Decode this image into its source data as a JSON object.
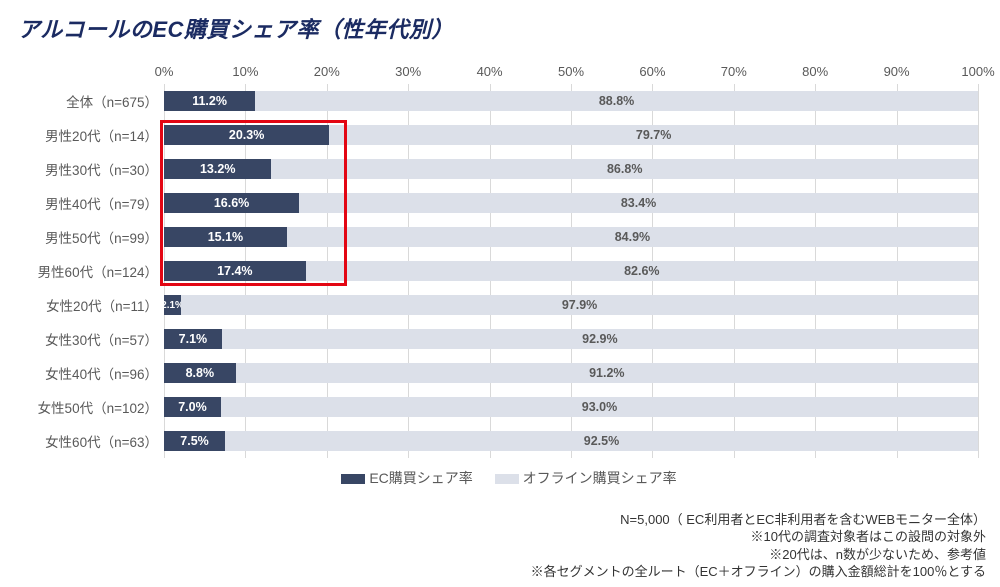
{
  "title": "アルコールのEC購買シェア率（性年代別）",
  "chart_data": {
    "type": "bar",
    "orientation": "horizontal-stacked-100",
    "categories": [
      "全体（n=675）",
      "男性20代（n=14）",
      "男性30代（n=30）",
      "男性40代（n=79）",
      "男性50代（n=99）",
      "男性60代（n=124）",
      "女性20代（n=11）",
      "女性30代（n=57）",
      "女性40代（n=96）",
      "女性50代（n=102）",
      "女性60代（n=63）"
    ],
    "series": [
      {
        "name": "EC購買シェア率",
        "color": "#384664",
        "values": [
          11.2,
          20.3,
          13.2,
          16.6,
          15.1,
          17.4,
          2.1,
          7.1,
          8.8,
          7.0,
          7.5
        ],
        "labels": [
          "11.2%",
          "20.3%",
          "13.2%",
          "16.6%",
          "15.1%",
          "17.4%",
          "2.1%",
          "7.1%",
          "8.8%",
          "7.0%",
          "7.5%"
        ]
      },
      {
        "name": "オフライン購買シェア率",
        "color": "#dce0e9",
        "values": [
          88.8,
          79.7,
          86.8,
          83.4,
          84.9,
          82.6,
          97.9,
          92.9,
          91.2,
          93.0,
          92.5
        ],
        "labels": [
          "88.8%",
          "79.7%",
          "86.8%",
          "83.4%",
          "84.9%",
          "82.6%",
          "97.9%",
          "92.9%",
          "91.2%",
          "93.0%",
          "92.5%"
        ]
      }
    ],
    "xticks": [
      "0%",
      "10%",
      "20%",
      "30%",
      "40%",
      "50%",
      "60%",
      "70%",
      "80%",
      "90%",
      "100%"
    ],
    "xlim": [
      0,
      100
    ],
    "highlight_rows": [
      1,
      2,
      3,
      4,
      5
    ]
  },
  "legend": {
    "ec": "EC購買シェア率",
    "off": "オフライン購買シェア率"
  },
  "notes": {
    "l1": "N=5,000（ EC利用者とEC非利用者を含むWEBモニター全体）",
    "l2": "※10代の調査対象者はこの設問の対象外",
    "l3": "※20代は、n数が少ないため、参考値",
    "l4": "※各セグメントの全ルート（EC＋オフライン）の購入金額総計を100％とする"
  }
}
